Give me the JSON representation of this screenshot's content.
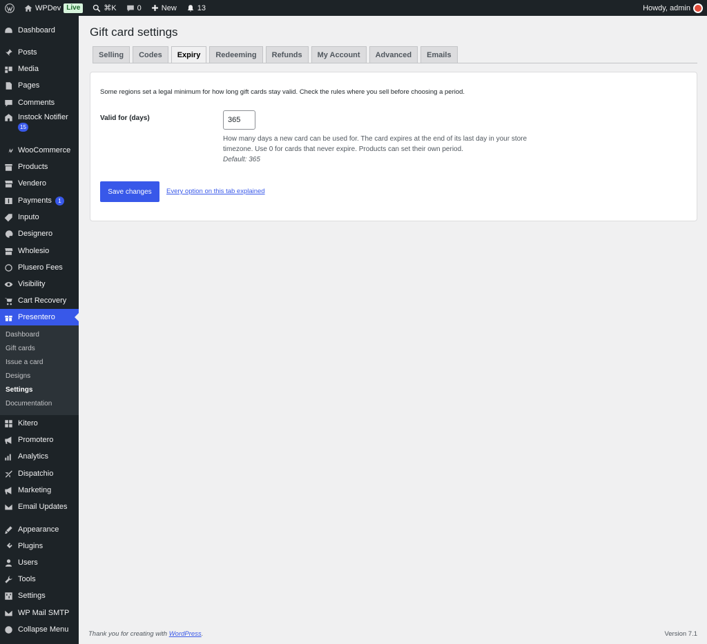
{
  "admin_bar": {
    "site_name": "WPDev",
    "live_badge": "Live",
    "shortcut": "⌘K",
    "comments_count": "0",
    "new_label": "New",
    "notifications_count": "13",
    "greeting": "Howdy, admin"
  },
  "sidebar": {
    "items": [
      {
        "label": "Dashboard",
        "icon": "dashboard-icon"
      },
      {
        "label": "Posts",
        "icon": "pin-icon"
      },
      {
        "label": "Media",
        "icon": "media-icon"
      },
      {
        "label": "Pages",
        "icon": "pages-icon"
      },
      {
        "label": "Comments",
        "icon": "comment-icon"
      },
      {
        "label": "Instock Notifier",
        "icon": "store-icon",
        "badge": "15"
      },
      {
        "label": "WooCommerce",
        "icon": "woo-icon"
      },
      {
        "label": "Products",
        "icon": "archive-icon"
      },
      {
        "label": "Vendero",
        "icon": "storefront-icon"
      },
      {
        "label": "Payments",
        "icon": "dollar-icon",
        "badge": "1"
      },
      {
        "label": "Inputo",
        "icon": "tag-icon"
      },
      {
        "label": "Designero",
        "icon": "palette-icon"
      },
      {
        "label": "Wholesio",
        "icon": "storefront-icon"
      },
      {
        "label": "Plusero Fees",
        "icon": "coin-icon"
      },
      {
        "label": "Visibility",
        "icon": "eye-icon"
      },
      {
        "label": "Cart Recovery",
        "icon": "cart-icon"
      },
      {
        "label": "Presentero",
        "icon": "gift-icon"
      },
      {
        "label": "Kitero",
        "icon": "grid-icon"
      },
      {
        "label": "Promotero",
        "icon": "megaphone-icon"
      },
      {
        "label": "Analytics",
        "icon": "chart-icon"
      },
      {
        "label": "Dispatchio",
        "icon": "plane-icon"
      },
      {
        "label": "Marketing",
        "icon": "megaphone-icon"
      },
      {
        "label": "Email Updates",
        "icon": "envelope-icon"
      },
      {
        "label": "Appearance",
        "icon": "brush-icon"
      },
      {
        "label": "Plugins",
        "icon": "plug-icon"
      },
      {
        "label": "Users",
        "icon": "user-icon"
      },
      {
        "label": "Tools",
        "icon": "wrench-icon"
      },
      {
        "label": "Settings",
        "icon": "settings-icon"
      },
      {
        "label": "WP Mail SMTP",
        "icon": "mail-icon"
      },
      {
        "label": "Collapse Menu",
        "icon": "collapse-icon"
      }
    ],
    "current": "Presentero",
    "submenu": [
      "Dashboard",
      "Gift cards",
      "Issue a card",
      "Designs",
      "Settings",
      "Documentation"
    ],
    "submenu_active": "Settings"
  },
  "page": {
    "title": "Gift card settings",
    "tabs": [
      "Selling",
      "Codes",
      "Expiry",
      "Redeeming",
      "Refunds",
      "My Account",
      "Advanced",
      "Emails"
    ],
    "active_tab": "Expiry",
    "intro": "Some regions set a legal minimum for how long gift cards stay valid. Check the rules where you sell before choosing a period.",
    "field_label": "Valid for (days)",
    "field_value": "365",
    "description": "How many days a new card can be used for. The card expires at the end of its last day in your store timezone. Use 0 for cards that never expire. Products can set their own period.",
    "default_text": "Default: 365",
    "save_label": "Save changes",
    "doc_link": "Every option on this tab explained"
  },
  "footer": {
    "thanks_prefix": "Thank you for creating with ",
    "thanks_link": "WordPress",
    "thanks_suffix": ".",
    "version": "Version 7.1"
  },
  "colors": {
    "accent": "#3858e9",
    "admin_bg": "#1d2327",
    "page_bg": "#f0f0f1"
  }
}
